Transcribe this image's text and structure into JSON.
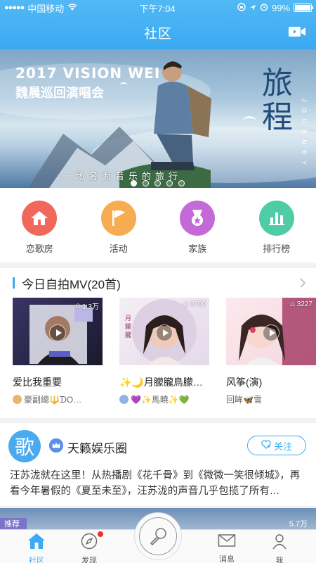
{
  "status_bar": {
    "carrier": "中国移动",
    "time": "下午7:04",
    "battery": "99%",
    "battery_level": 0.99
  },
  "header": {
    "title": "社区",
    "video_icon": "video-camera-icon"
  },
  "banner": {
    "title_line1": "2017 VISION WEI",
    "title_line2": "魏晨巡回演唱会",
    "big_title": "旅程",
    "journey_text": "J O U R N E Y",
    "slogan": "一场名为音乐的旅行",
    "page_count": 5,
    "active_page": 0
  },
  "quick_menu": [
    {
      "label": "恋歌房",
      "icon": "home-icon",
      "color": "#f0685c"
    },
    {
      "label": "活动",
      "icon": "flag-icon",
      "color": "#f6ad52"
    },
    {
      "label": "家族",
      "icon": "medal-icon",
      "color": "#c36ad8"
    },
    {
      "label": "排行榜",
      "icon": "bar-chart-icon",
      "color": "#4fcca5"
    }
  ],
  "mv_section": {
    "title": "今日自拍MV(20首)",
    "items": [
      {
        "count": "1.3万",
        "name": "爱比我重要",
        "author": "豪副總🔱ᗪO…"
      },
      {
        "count": "9700",
        "name": "✨🌙月朦朧鳥朦…",
        "author": "💜✨馬曉✨💚"
      },
      {
        "count": "3227",
        "name": "风筝(演)",
        "author": "回眸🦋雪"
      }
    ]
  },
  "post": {
    "avatar_char": "歌",
    "username": "天籁娱乐圈",
    "follow_label": "关注",
    "text": "汪苏泷就在这里！从热播剧《花千骨》到《微微一笑很倾城》，再看今年暑假的《夏至未至》，汪苏泷的声音几乎包揽了所有…"
  },
  "peek": {
    "tag": "推荐",
    "count": "5.7万"
  },
  "tabbar": [
    {
      "label": "社区",
      "icon": "home-icon",
      "active": true
    },
    {
      "label": "发现",
      "icon": "compass-icon",
      "badge": true
    },
    {
      "label": "消息",
      "icon": "mail-icon"
    },
    {
      "label": "我",
      "icon": "person-icon"
    }
  ]
}
